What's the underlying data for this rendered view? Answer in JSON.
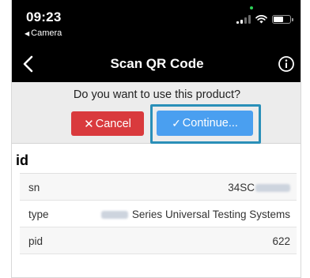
{
  "status_bar": {
    "time": "09:23",
    "back_app_label": "Camera",
    "back_app_icon": "back-triangle-icon",
    "accent": "#2ed158"
  },
  "nav": {
    "title": "Scan QR Code",
    "back_icon": "chevron-left-icon",
    "info_icon": "info-circle-icon"
  },
  "prompt": {
    "question": "Do you want to use this product?",
    "cancel_label": "Cancel",
    "continue_label": "Continue...",
    "colors": {
      "cancel": "#d93a3d",
      "continue": "#4a9ff0",
      "highlight": "#2a8fb8"
    }
  },
  "section": {
    "title": "id",
    "rows": [
      {
        "key": "sn",
        "value_prefix": "34SC",
        "value_suffix": ""
      },
      {
        "key": "type",
        "value_prefix": "",
        "value_suffix": "Series Universal Testing Systems"
      },
      {
        "key": "pid",
        "value_prefix": "",
        "value_suffix": "622"
      }
    ]
  }
}
